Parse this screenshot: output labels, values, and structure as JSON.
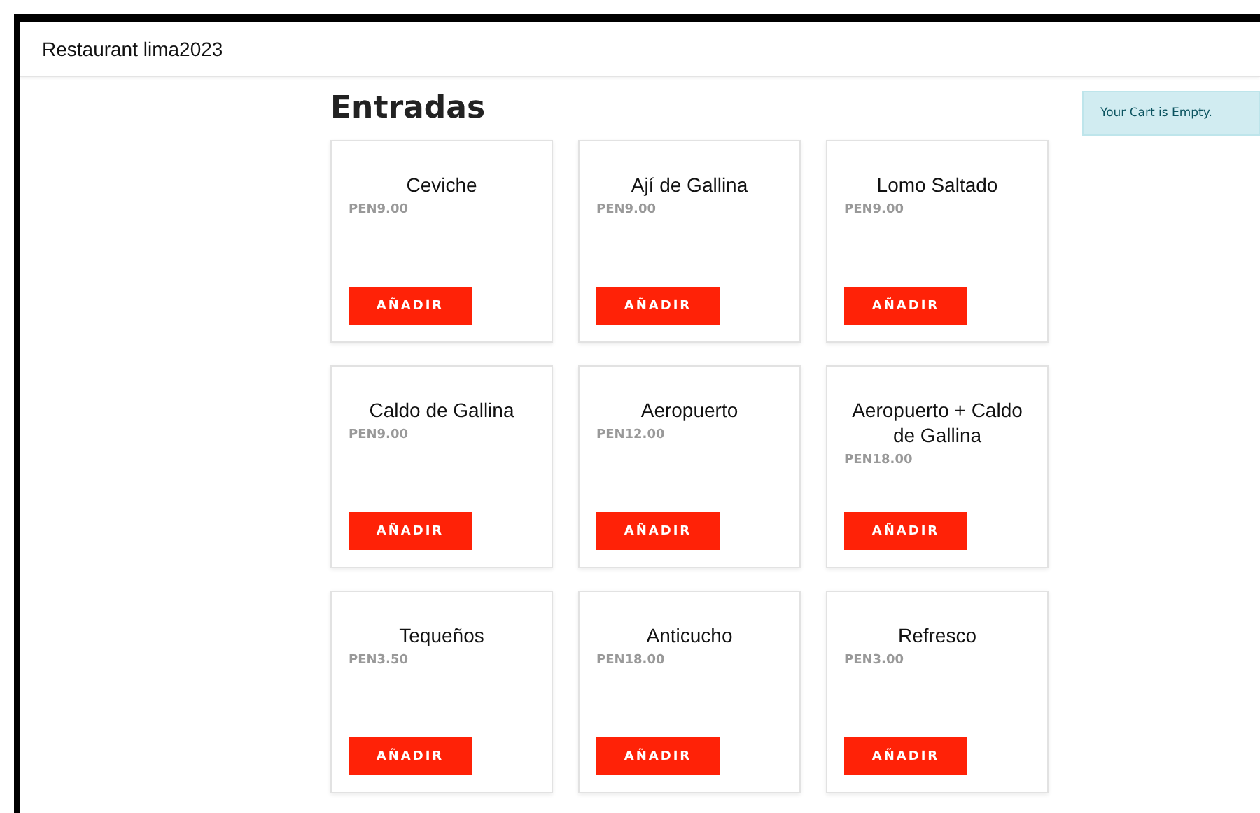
{
  "header": {
    "title": "Restaurant lima2023"
  },
  "section": {
    "title": "Entradas"
  },
  "cart": {
    "message": "Your Cart is Empty."
  },
  "products": [
    {
      "name": "Ceviche",
      "price": "PEN9.00",
      "button": "AÑADIR"
    },
    {
      "name": "Ají de Gallina",
      "price": "PEN9.00",
      "button": "AÑADIR"
    },
    {
      "name": "Lomo Saltado",
      "price": "PEN9.00",
      "button": "AÑADIR"
    },
    {
      "name": "Caldo de Gallina",
      "price": "PEN9.00",
      "button": "AÑADIR"
    },
    {
      "name": "Aeropuerto",
      "price": "PEN12.00",
      "button": "AÑADIR"
    },
    {
      "name": "Aeropuerto + Caldo de Gallina",
      "price": "PEN18.00",
      "button": "AÑADIR"
    },
    {
      "name": "Tequeños",
      "price": "PEN3.50",
      "button": "AÑADIR"
    },
    {
      "name": "Anticucho",
      "price": "PEN18.00",
      "button": "AÑADIR"
    },
    {
      "name": "Refresco",
      "price": "PEN3.00",
      "button": "AÑADIR"
    }
  ]
}
